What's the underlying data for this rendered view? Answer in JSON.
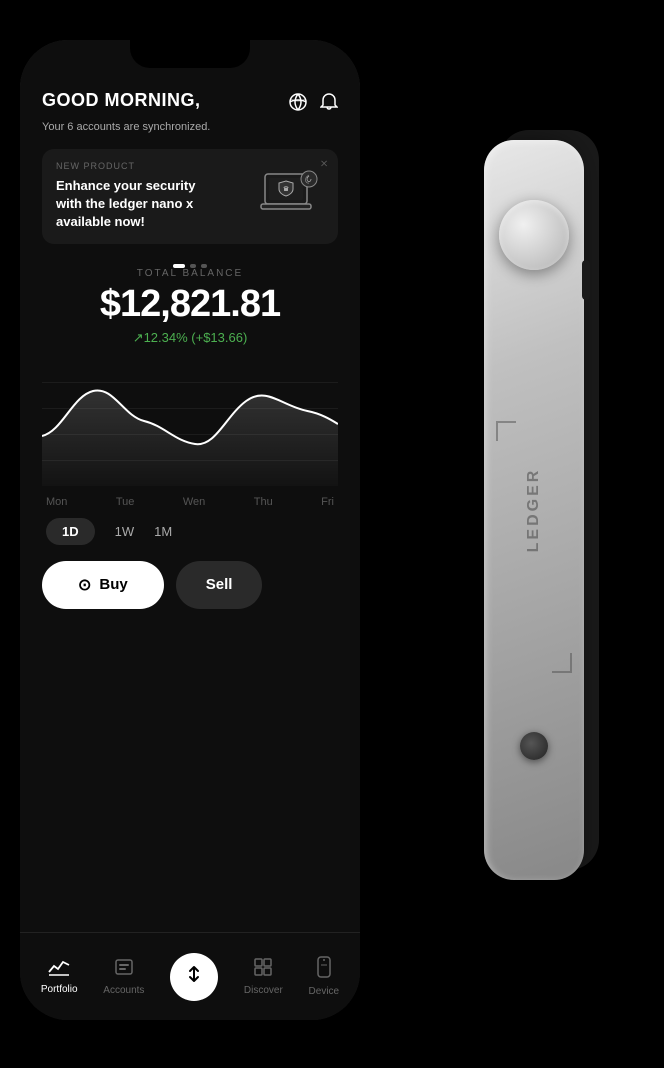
{
  "phone": {
    "greeting": "GOOD MORNING,",
    "sync_text": "Your 6 accounts are synchronized.",
    "header_icons": {
      "globe": "⊕",
      "bell": "🔔"
    }
  },
  "banner": {
    "tag": "NEW PRODUCT",
    "title": "Enhance your security with the ledger nano x available now!",
    "close": "×"
  },
  "balance": {
    "label": "TOTAL BALANCE",
    "amount": "$12,821.81",
    "change": "↗12.34% (+$13.66)"
  },
  "chart": {
    "time_labels": [
      "Mon",
      "Tue",
      "Wen",
      "Thu",
      "Fri"
    ]
  },
  "time_range": {
    "options": [
      "1D",
      "1W",
      "1M"
    ],
    "active": "1D"
  },
  "actions": {
    "buy_label": "Buy",
    "secondary_label": "Sell"
  },
  "nav": {
    "items": [
      {
        "id": "portfolio",
        "label": "Portfolio",
        "active": true
      },
      {
        "id": "accounts",
        "label": "Accounts",
        "active": false
      },
      {
        "id": "transfer",
        "label": "",
        "active": false,
        "center": true
      },
      {
        "id": "discover",
        "label": "Discover",
        "active": false
      },
      {
        "id": "device",
        "label": "Device",
        "active": false
      }
    ]
  },
  "device": {
    "logo": "LEDGER"
  },
  "colors": {
    "accent": "#4caf50",
    "background": "#0e0e0e",
    "card": "#1a1a1a",
    "text_primary": "#ffffff",
    "text_secondary": "#aaaaaa"
  }
}
